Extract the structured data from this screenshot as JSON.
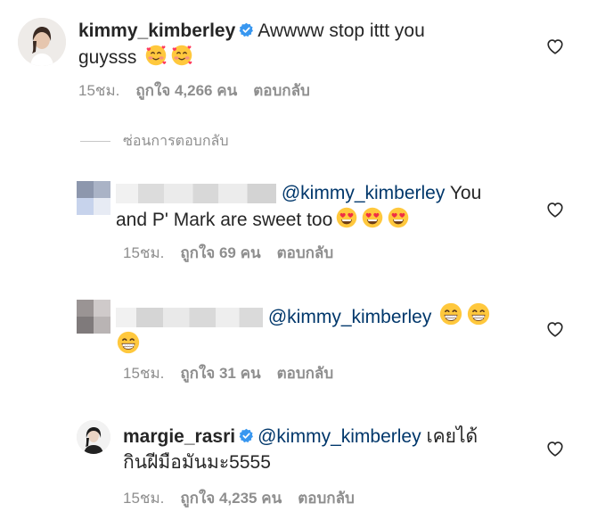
{
  "comments": [
    {
      "username": "kimmy_kimberley",
      "text_line1": "Awwww stop ittt you",
      "text_line2": "guysss",
      "time": "15ชม.",
      "likes": "ถูกใจ 4,266 คน",
      "reply": "ตอบกลับ"
    },
    {
      "mention": "@kimmy_kimberley",
      "text_after_mention": "You",
      "text_line2": "and P' Mark are sweet too",
      "time": "15ชม.",
      "likes": "ถูกใจ 69 คน",
      "reply": "ตอบกลับ"
    },
    {
      "mention": "@kimmy_kimberley",
      "time": "15ชม.",
      "likes": "ถูกใจ 31 คน",
      "reply": "ตอบกลับ"
    },
    {
      "username": "margie_rasri",
      "mention": "@kimmy_kimberley",
      "text_after_mention": "เคยได้",
      "text_line2": "กินฝีมือมันมะ5555",
      "time": "15ชม.",
      "likes": "ถูกใจ 4,235 คน",
      "reply": "ตอบกลับ"
    }
  ],
  "hide_replies": "ซ่อนการตอบกลับ",
  "colors": {
    "mention": "#00376b",
    "meta": "#8e8e8e",
    "verified": "#3897f0"
  },
  "icons": [
    "verified-badge-icon",
    "heart-icon",
    "smiling-face-with-hearts-emoji",
    "heart-eyes-emoji",
    "grinning-emoji"
  ]
}
